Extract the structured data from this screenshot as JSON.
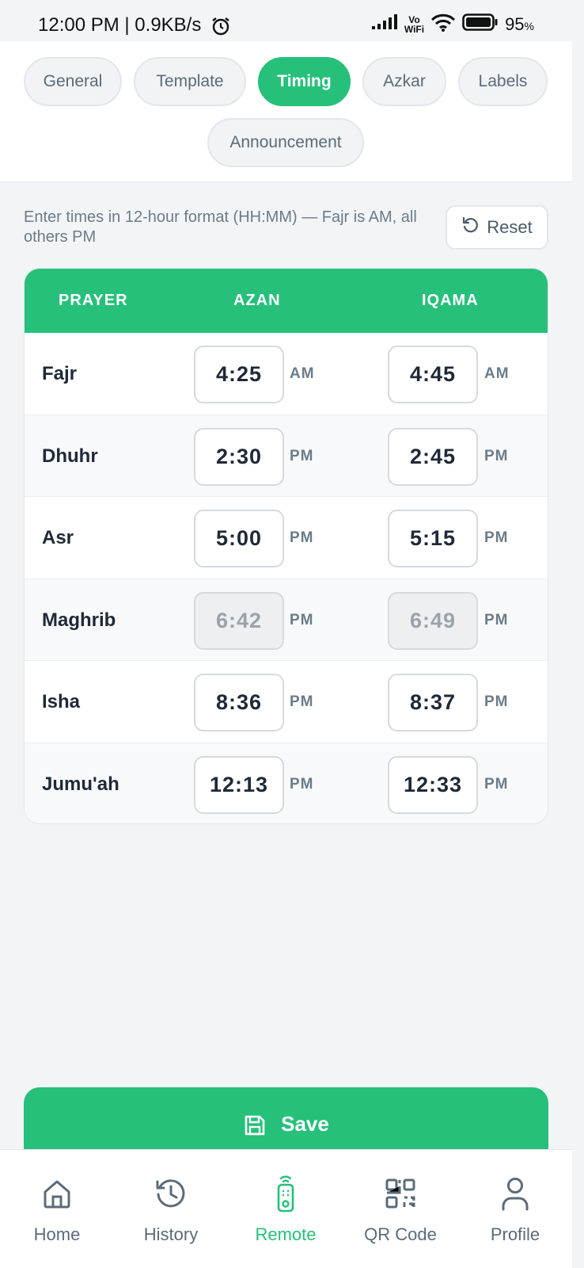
{
  "status_bar": {
    "time": "12:00 PM | 0.9KB/s",
    "battery": "95"
  },
  "tabs": [
    {
      "label": "General",
      "active": false
    },
    {
      "label": "Template",
      "active": false
    },
    {
      "label": "Timing",
      "active": true
    },
    {
      "label": "Azkar",
      "active": false
    },
    {
      "label": "Labels",
      "active": false
    },
    {
      "label": "Announcement",
      "active": false
    }
  ],
  "hint": "Enter times in 12-hour format (HH:MM) — Fajr is AM, all others PM",
  "reset_label": "Reset",
  "table": {
    "headers": [
      "PRAYER",
      "AZAN",
      "IQAMA"
    ],
    "rows": [
      {
        "prayer": "Fajr",
        "azan": "4:25",
        "azan_period": "AM",
        "iqama": "4:45",
        "iqama_period": "AM",
        "editable": true
      },
      {
        "prayer": "Dhuhr",
        "azan": "2:30",
        "azan_period": "PM",
        "iqama": "2:45",
        "iqama_period": "PM",
        "editable": true
      },
      {
        "prayer": "Asr",
        "azan": "5:00",
        "azan_period": "PM",
        "iqama": "5:15",
        "iqama_period": "PM",
        "editable": true
      },
      {
        "prayer": "Maghrib",
        "azan": "6:42",
        "azan_period": "PM",
        "iqama": "6:49",
        "iqama_period": "PM",
        "editable": false
      },
      {
        "prayer": "Isha",
        "azan": "8:36",
        "azan_period": "PM",
        "iqama": "8:37",
        "iqama_period": "PM",
        "editable": true
      },
      {
        "prayer": "Jumu'ah",
        "azan": "12:13",
        "azan_period": "PM",
        "iqama": "12:33",
        "iqama_period": "PM",
        "editable": true
      }
    ]
  },
  "save_label": "Save",
  "nav": [
    {
      "label": "Home",
      "icon": "home-icon",
      "active": false
    },
    {
      "label": "History",
      "icon": "history-icon",
      "active": false
    },
    {
      "label": "Remote",
      "icon": "remote-icon",
      "active": true
    },
    {
      "label": "QR Code",
      "icon": "qr-code-icon",
      "active": false
    },
    {
      "label": "Profile",
      "icon": "profile-icon",
      "active": false
    }
  ],
  "colors": {
    "accent": "#26c07a",
    "background": "#f3f4f6",
    "text_muted": "#6b7c88"
  }
}
